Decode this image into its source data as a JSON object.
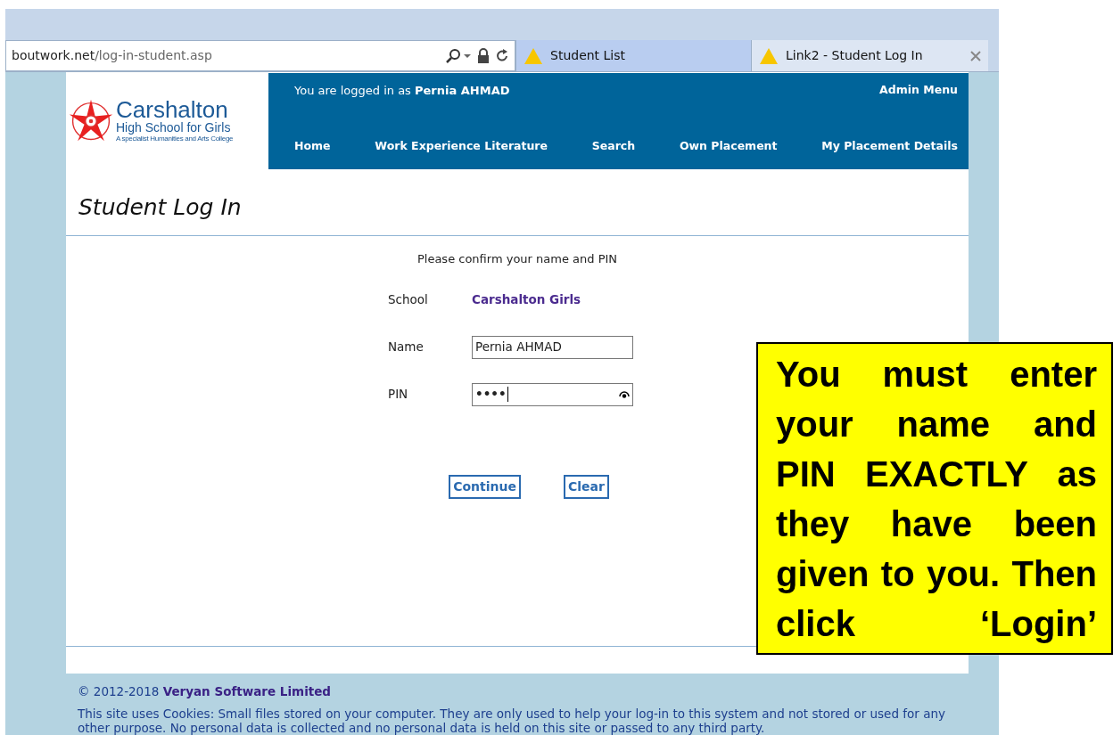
{
  "browser": {
    "address_host": "boutwork.net",
    "address_path": "/log-in-student.asp",
    "tabs": [
      {
        "label": "Student List",
        "selected": false
      },
      {
        "label": "Link2 - Student Log In",
        "selected": true
      }
    ]
  },
  "header": {
    "logo": {
      "name": "Carshalton",
      "subtitle": "High School for Girls",
      "tagline": "A specialist Humanities and Arts College"
    },
    "logged_in": "You are logged in as **Pernia AHMAD**",
    "admin_menu": "Admin Menu",
    "nav": [
      "Home",
      "Work Experience Literature",
      "Search",
      "Own Placement",
      "My Placement Details"
    ]
  },
  "page_title": "Student Log In",
  "form": {
    "intro": "Please confirm your name and PIN",
    "fields": [
      {
        "kind": "static",
        "label": "School",
        "value": "Carshalton Girls"
      },
      {
        "kind": "text",
        "label": "Name",
        "value": "Pernia AHMAD"
      },
      {
        "kind": "password",
        "label": "PIN",
        "value": "••••"
      }
    ],
    "buttons": [
      "Continue",
      "Clear"
    ]
  },
  "footer": {
    "copyright": "© 2012-2018 **Veryan Software Limited**",
    "cookies": "This site uses Cookies: Small files stored on your computer. They are only used to help your log-in to this system and not stored or used for any other purpose. No personal data is collected and no personal data is held on this site or passed to any third party."
  },
  "callout": "You must enter your name and PIN EXACTLY as they have been given to you. Then click ‘Login’"
}
